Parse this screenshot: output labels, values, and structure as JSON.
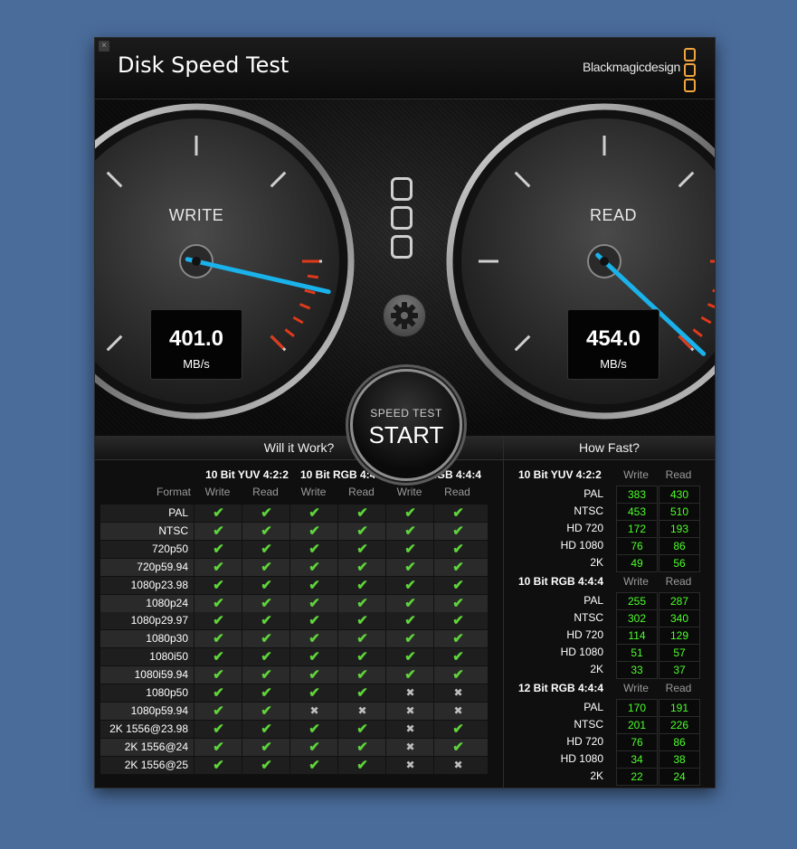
{
  "window": {
    "close_label": "×",
    "title": "Disk Speed Test",
    "brand": "Blackmagicdesign"
  },
  "gauges": {
    "write": {
      "label": "WRITE",
      "value": "401.0",
      "unit": "MB/s"
    },
    "read": {
      "label": "READ",
      "value": "454.0",
      "unit": "MB/s"
    }
  },
  "start": {
    "top": "SPEED TEST",
    "label": "START"
  },
  "will_it_work": {
    "title": "Will it Work?",
    "groups": [
      "10 Bit YUV 4:2:2",
      "10 Bit RGB 4:4:4",
      "12 Bit RGB 4:4:4"
    ],
    "format_header": "Format",
    "sub_headers": [
      "Write",
      "Read",
      "Write",
      "Read",
      "Write",
      "Read"
    ],
    "rows": [
      {
        "name": "PAL",
        "marks": [
          "✔",
          "✔",
          "✔",
          "✔",
          "✔",
          "✔"
        ]
      },
      {
        "name": "NTSC",
        "marks": [
          "✔",
          "✔",
          "✔",
          "✔",
          "✔",
          "✔"
        ]
      },
      {
        "name": "720p50",
        "marks": [
          "✔",
          "✔",
          "✔",
          "✔",
          "✔",
          "✔"
        ]
      },
      {
        "name": "720p59.94",
        "marks": [
          "✔",
          "✔",
          "✔",
          "✔",
          "✔",
          "✔"
        ]
      },
      {
        "name": "1080p23.98",
        "marks": [
          "✔",
          "✔",
          "✔",
          "✔",
          "✔",
          "✔"
        ]
      },
      {
        "name": "1080p24",
        "marks": [
          "✔",
          "✔",
          "✔",
          "✔",
          "✔",
          "✔"
        ]
      },
      {
        "name": "1080p29.97",
        "marks": [
          "✔",
          "✔",
          "✔",
          "✔",
          "✔",
          "✔"
        ]
      },
      {
        "name": "1080p30",
        "marks": [
          "✔",
          "✔",
          "✔",
          "✔",
          "✔",
          "✔"
        ]
      },
      {
        "name": "1080i50",
        "marks": [
          "✔",
          "✔",
          "✔",
          "✔",
          "✔",
          "✔"
        ]
      },
      {
        "name": "1080i59.94",
        "marks": [
          "✔",
          "✔",
          "✔",
          "✔",
          "✔",
          "✔"
        ]
      },
      {
        "name": "1080p50",
        "marks": [
          "✔",
          "✔",
          "✔",
          "✔",
          "✖",
          "✖"
        ]
      },
      {
        "name": "1080p59.94",
        "marks": [
          "✔",
          "✔",
          "✖",
          "✖",
          "✖",
          "✖"
        ]
      },
      {
        "name": "2K 1556@23.98",
        "marks": [
          "✔",
          "✔",
          "✔",
          "✔",
          "✖",
          "✔"
        ]
      },
      {
        "name": "2K 1556@24",
        "marks": [
          "✔",
          "✔",
          "✔",
          "✔",
          "✖",
          "✔"
        ]
      },
      {
        "name": "2K 1556@25",
        "marks": [
          "✔",
          "✔",
          "✔",
          "✔",
          "✖",
          "✖"
        ]
      }
    ]
  },
  "how_fast": {
    "title": "How Fast?",
    "write_label": "Write",
    "read_label": "Read",
    "sections": [
      {
        "name": "10 Bit YUV 4:2:2",
        "rows": [
          {
            "name": "PAL",
            "write": "383",
            "read": "430"
          },
          {
            "name": "NTSC",
            "write": "453",
            "read": "510"
          },
          {
            "name": "HD 720",
            "write": "172",
            "read": "193"
          },
          {
            "name": "HD 1080",
            "write": "76",
            "read": "86"
          },
          {
            "name": "2K",
            "write": "49",
            "read": "56"
          }
        ]
      },
      {
        "name": "10 Bit RGB 4:4:4",
        "rows": [
          {
            "name": "PAL",
            "write": "255",
            "read": "287"
          },
          {
            "name": "NTSC",
            "write": "302",
            "read": "340"
          },
          {
            "name": "HD 720",
            "write": "114",
            "read": "129"
          },
          {
            "name": "HD 1080",
            "write": "51",
            "read": "57"
          },
          {
            "name": "2K",
            "write": "33",
            "read": "37"
          }
        ]
      },
      {
        "name": "12 Bit RGB 4:4:4",
        "rows": [
          {
            "name": "PAL",
            "write": "170",
            "read": "191"
          },
          {
            "name": "NTSC",
            "write": "201",
            "read": "226"
          },
          {
            "name": "HD 720",
            "write": "76",
            "read": "86"
          },
          {
            "name": "HD 1080",
            "write": "34",
            "read": "38"
          },
          {
            "name": "2K",
            "write": "22",
            "read": "24"
          }
        ]
      }
    ]
  },
  "colors": {
    "check": "#5ed33a",
    "value": "#4cff2a",
    "needle": "#1ab2ea",
    "redzone": "#e0391a",
    "brand": "#f1a53d"
  }
}
